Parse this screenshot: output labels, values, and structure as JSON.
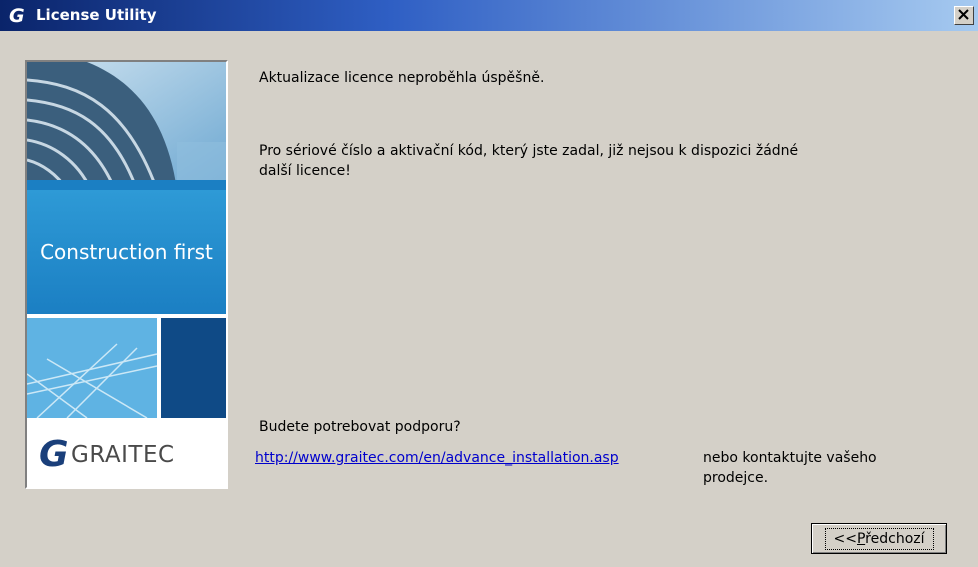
{
  "window": {
    "title": "License Utility",
    "icons": {
      "app": "graitec-logo-icon",
      "close": "close-icon"
    }
  },
  "side_panel": {
    "tagline": "Construction first",
    "brand": "GRAITEC"
  },
  "message": {
    "line1": "Aktualizace licence neproběhla úspěšně.",
    "line2a": "Pro sériové číslo a aktivační kód, který jste zadal, již nejsou k dispozici žádné",
    "line2b": "další licence!"
  },
  "support": {
    "question": "Budete potrebovat podporu?",
    "link": "http://www.graitec.com/en/advance_installation.asp",
    "contact_a": "nebo kontaktujte vašeho",
    "contact_b": "prodejce."
  },
  "buttons": {
    "back_prefix": "<<",
    "back_accel": "P",
    "back_rest": "ředchozí"
  },
  "colors": {
    "titlebar_start": "#0a246a",
    "titlebar_end": "#a6caf0",
    "dialog_bg": "#d4d0c8",
    "brand_blue": "#1b7fc3",
    "link": "#0000cc"
  }
}
